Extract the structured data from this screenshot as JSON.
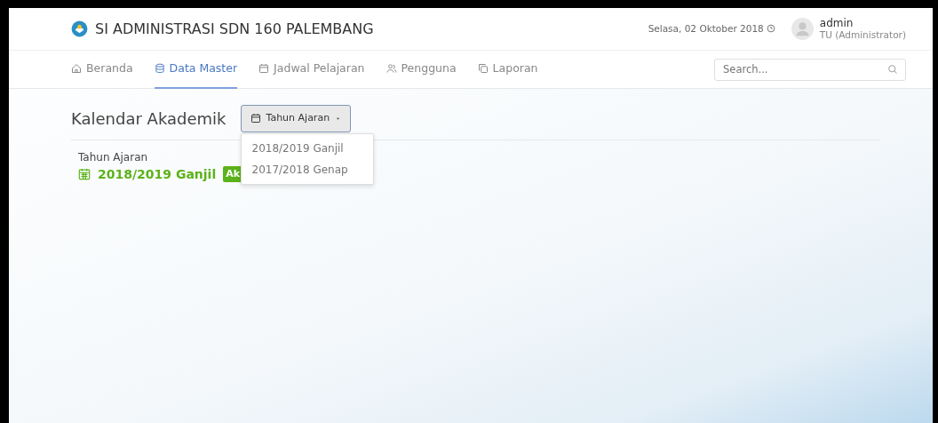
{
  "header": {
    "title": "SI ADMINISTRASI SDN 160 PALEMBANG",
    "date": "Selasa, 02 Oktober 2018",
    "user": {
      "name": "admin",
      "role": "TU (Administrator)"
    }
  },
  "nav": [
    {
      "label": "Beranda",
      "selected": false
    },
    {
      "label": "Data Master",
      "selected": true
    },
    {
      "label": "Jadwal Pelajaran",
      "selected": false
    },
    {
      "label": "Pengguna",
      "selected": false
    },
    {
      "label": "Laporan",
      "selected": false
    }
  ],
  "search": {
    "placeholder": "Search..."
  },
  "page": {
    "title": "Kalendar Akademik",
    "dropdown": {
      "label": "Tahun Ajaran",
      "expanded": true,
      "options": [
        "2018/2019 Ganjil",
        "2017/2018 Genap"
      ]
    },
    "field_label": "Tahun Ajaran",
    "field_value": "2018/2019 Ganjil",
    "badge": "Ak"
  }
}
